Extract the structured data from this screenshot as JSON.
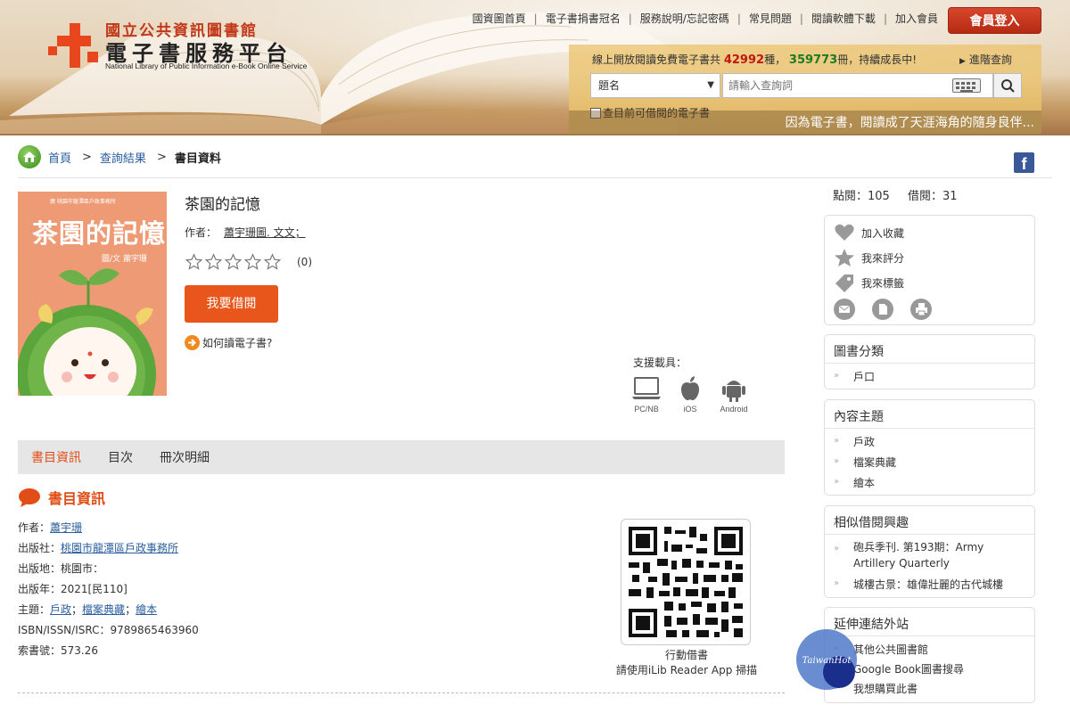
{
  "header": {
    "logo_small": "國立公共資訊圖書館",
    "logo_big": "電子書服務平台",
    "logo_en": "National Library of Public Information e-Book Online Service",
    "nav": [
      "國資圖首頁",
      "電子書捐書冠名",
      "服務說明/忘記密碼",
      "常見問題",
      "閱讀軟體下載",
      "加入會員"
    ],
    "login_label": "會員登入",
    "stats_prefix": "線上開放閱讀免費電子書共",
    "stats_titles": "42992",
    "stats_titles_unit": "種，",
    "stats_copies": "359773",
    "stats_copies_unit": "冊",
    "stats_suffix": "，持續成長中!",
    "advanced_search": "進階查詢",
    "search_field": "題名",
    "search_placeholder": "請輸入查詢詞",
    "borrowable_only": "查目前可借閱的電子書",
    "slogan": "因為電子書，閱讀成了天涯海角的隨身良伴..."
  },
  "breadcrumb": {
    "home": "首頁",
    "results": "查詢結果",
    "current": "書目資料"
  },
  "book": {
    "title": "茶園的記憶",
    "author_label": "作者：",
    "author": "蕭宇珊圖. 文文；",
    "rating_count": "(0)",
    "borrow_label": "我要借閱",
    "howto_label": "如何讀電子書?",
    "cover_title": "茶園的記憶",
    "cover_sub": "圖/文 蕭宇珊",
    "cover_top": "廣 桃園市龍潭區戶政事務所"
  },
  "devices": {
    "label": "支援載具：",
    "items": [
      "PC/NB",
      "iOS",
      "Android"
    ]
  },
  "tabs": [
    "書目資訊",
    "目次",
    "冊次明細"
  ],
  "section_title": "書目資訊",
  "meta": {
    "author_label": "作者：",
    "author": "蕭宇珊",
    "publisher_label": "出版社：",
    "publisher": "桃園市龍潭區戶政事務所",
    "place_label": "出版地：",
    "place": "桃園市：",
    "year_label": "出版年：",
    "year": "2021[民110]",
    "subject_label": "主題：",
    "subjects": [
      "戶政",
      "檔案典藏",
      "繪本"
    ],
    "isbn_label": "ISBN/ISSN/ISRC：",
    "isbn": "9789865463960",
    "call_label": "索書號：",
    "call": "573.26"
  },
  "qr": {
    "caption1": "行動借書",
    "caption2": "請使用iLib Reader App 掃描"
  },
  "sidebar": {
    "views_label": "點閱：",
    "views": "105",
    "borrows_label": "借閱：",
    "borrows": "31",
    "actions": [
      "加入收藏",
      "我來評分",
      "我來標籤"
    ],
    "category_title": "圖書分類",
    "category_items": [
      "戶口"
    ],
    "topic_title": "內容主題",
    "topic_items": [
      "戶政",
      "檔案典藏",
      "繪本"
    ],
    "similar_title": "相似借閱興趣",
    "similar_items": [
      "砲兵季刊. 第193期：Army Artillery Quarterly",
      "城樓古景：雄偉壯麗的古代城樓"
    ],
    "links_title": "延伸連結外站",
    "links_items": [
      "其他公共圖書館",
      "Google Book圖書搜尋",
      "我想購買此書"
    ]
  },
  "watermark": "TaiwanHot",
  "colors": {
    "accent": "#e14d16",
    "link": "#2a5d9f",
    "brand_red": "#e8461d"
  }
}
